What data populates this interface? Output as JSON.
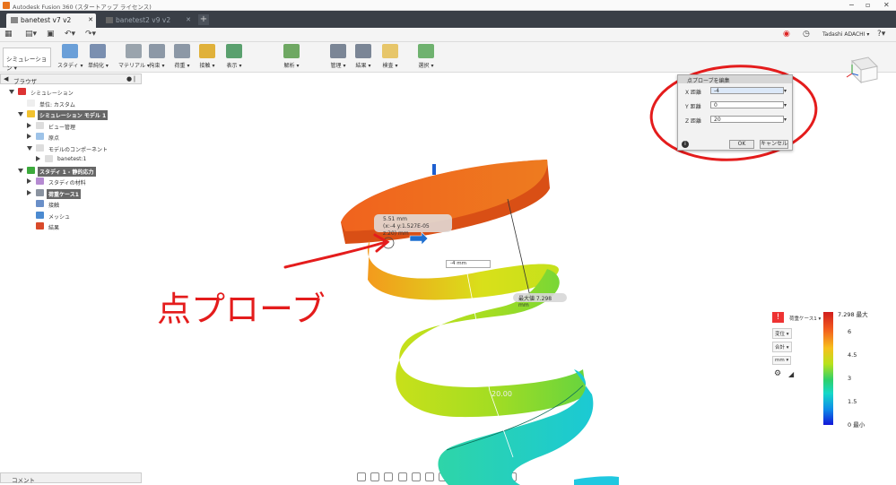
{
  "window": {
    "title": "Autodesk Fusion 360 (スタートアップ ライセンス)"
  },
  "tabs": [
    {
      "label": "banetest v7 v2",
      "active": true
    },
    {
      "label": "banetest2 v9 v2",
      "active": false
    }
  ],
  "user": {
    "name": "Tadashi ADACHI ▾"
  },
  "workspace": {
    "label": "シミュレーション ▾"
  },
  "ribbon": [
    {
      "label": "スタディ ▾",
      "color": "#6a9fd8"
    },
    {
      "label": "単純化 ▾",
      "color": "#7a8fb0"
    },
    {
      "label": "マテリアル ▾",
      "color": "#9aa4ad"
    },
    {
      "label": "拘束 ▾",
      "color": "#8c98a6"
    },
    {
      "label": "荷重 ▾",
      "color": "#8c98a6"
    },
    {
      "label": "接触 ▾",
      "color": "#e0b13a"
    },
    {
      "label": "表示 ▾",
      "color": "#5aa06e"
    },
    {
      "label": "解析 ▾",
      "color": "#6fa863"
    },
    {
      "label": "管理 ▾",
      "color": "#7b8696"
    },
    {
      "label": "結果 ▾",
      "color": "#7b8696"
    },
    {
      "label": "検査 ▾",
      "color": "#e7c66a"
    },
    {
      "label": "選択 ▾",
      "color": "#6fb26f"
    }
  ],
  "browser": {
    "title": "ブラウザ",
    "items": [
      {
        "label": "シミュレーション",
        "depth": 0,
        "toggle": "open",
        "icon": "#d33",
        "hl": false
      },
      {
        "label": "単位: カスタム",
        "depth": 1,
        "toggle": "",
        "icon": "#eee",
        "hl": false
      },
      {
        "label": "シミュレーション モデル 1",
        "depth": 1,
        "toggle": "open",
        "icon": "#f2c230",
        "hl": true
      },
      {
        "label": "ビュー管理",
        "depth": 2,
        "toggle": "closed",
        "icon": "#ddd",
        "hl": false
      },
      {
        "label": "原点",
        "depth": 2,
        "toggle": "closed",
        "icon": "#9ec3e8",
        "hl": false
      },
      {
        "label": "モデルのコンポーネント",
        "depth": 2,
        "toggle": "open",
        "icon": "#ddd",
        "hl": false
      },
      {
        "label": "banetest:1",
        "depth": 3,
        "toggle": "closed",
        "icon": "#ddd",
        "hl": false
      },
      {
        "label": "スタディ 1 - 静的応力",
        "depth": 1,
        "toggle": "open",
        "icon": "#3caa3c",
        "hl": true
      },
      {
        "label": "スタディの材料",
        "depth": 2,
        "toggle": "closed",
        "icon": "#b58ad1",
        "hl": false
      },
      {
        "label": "荷重ケース1",
        "depth": 2,
        "toggle": "closed",
        "icon": "#8a93a0",
        "hl": true
      },
      {
        "label": "接触",
        "depth": 2,
        "toggle": "",
        "icon": "#6a8fc8",
        "hl": false
      },
      {
        "label": "メッシュ",
        "depth": 2,
        "toggle": "",
        "icon": "#4b8ad0",
        "hl": false
      },
      {
        "label": "結果",
        "depth": 2,
        "toggle": "",
        "icon": "#d94a2a",
        "hl": false
      }
    ]
  },
  "comment": {
    "label": "コメント"
  },
  "probe_dialog": {
    "title": "点プローブを編集",
    "fields": [
      {
        "label": "X 距離",
        "value": "-4"
      },
      {
        "label": "Y 距離",
        "value": "0"
      },
      {
        "label": "Z 距離",
        "value": "20"
      }
    ],
    "ok_label": "OK",
    "cancel_label": "キャンセル",
    "info_icon": "i"
  },
  "probe_tooltip": {
    "line1": "5.51 mm",
    "line2": "(x:-4 y:1.527E-05 z:20) mm"
  },
  "max_label": "最大値  7.298 mm",
  "distance_input": "-4 mm",
  "dim_label": "20.00",
  "annotation_text": "点プローブ",
  "legend": {
    "loadcase": "荷重ケース1 ▾",
    "mode": "変位 ▾",
    "component": "合計 ▾",
    "unit": "mm ▾",
    "ticks": [
      "7.298 最大",
      "6",
      "4.5",
      "3",
      "1.5",
      "0 最小"
    ]
  },
  "colors": {
    "annotation": "#e41c1c",
    "accent": "#0696d7"
  }
}
